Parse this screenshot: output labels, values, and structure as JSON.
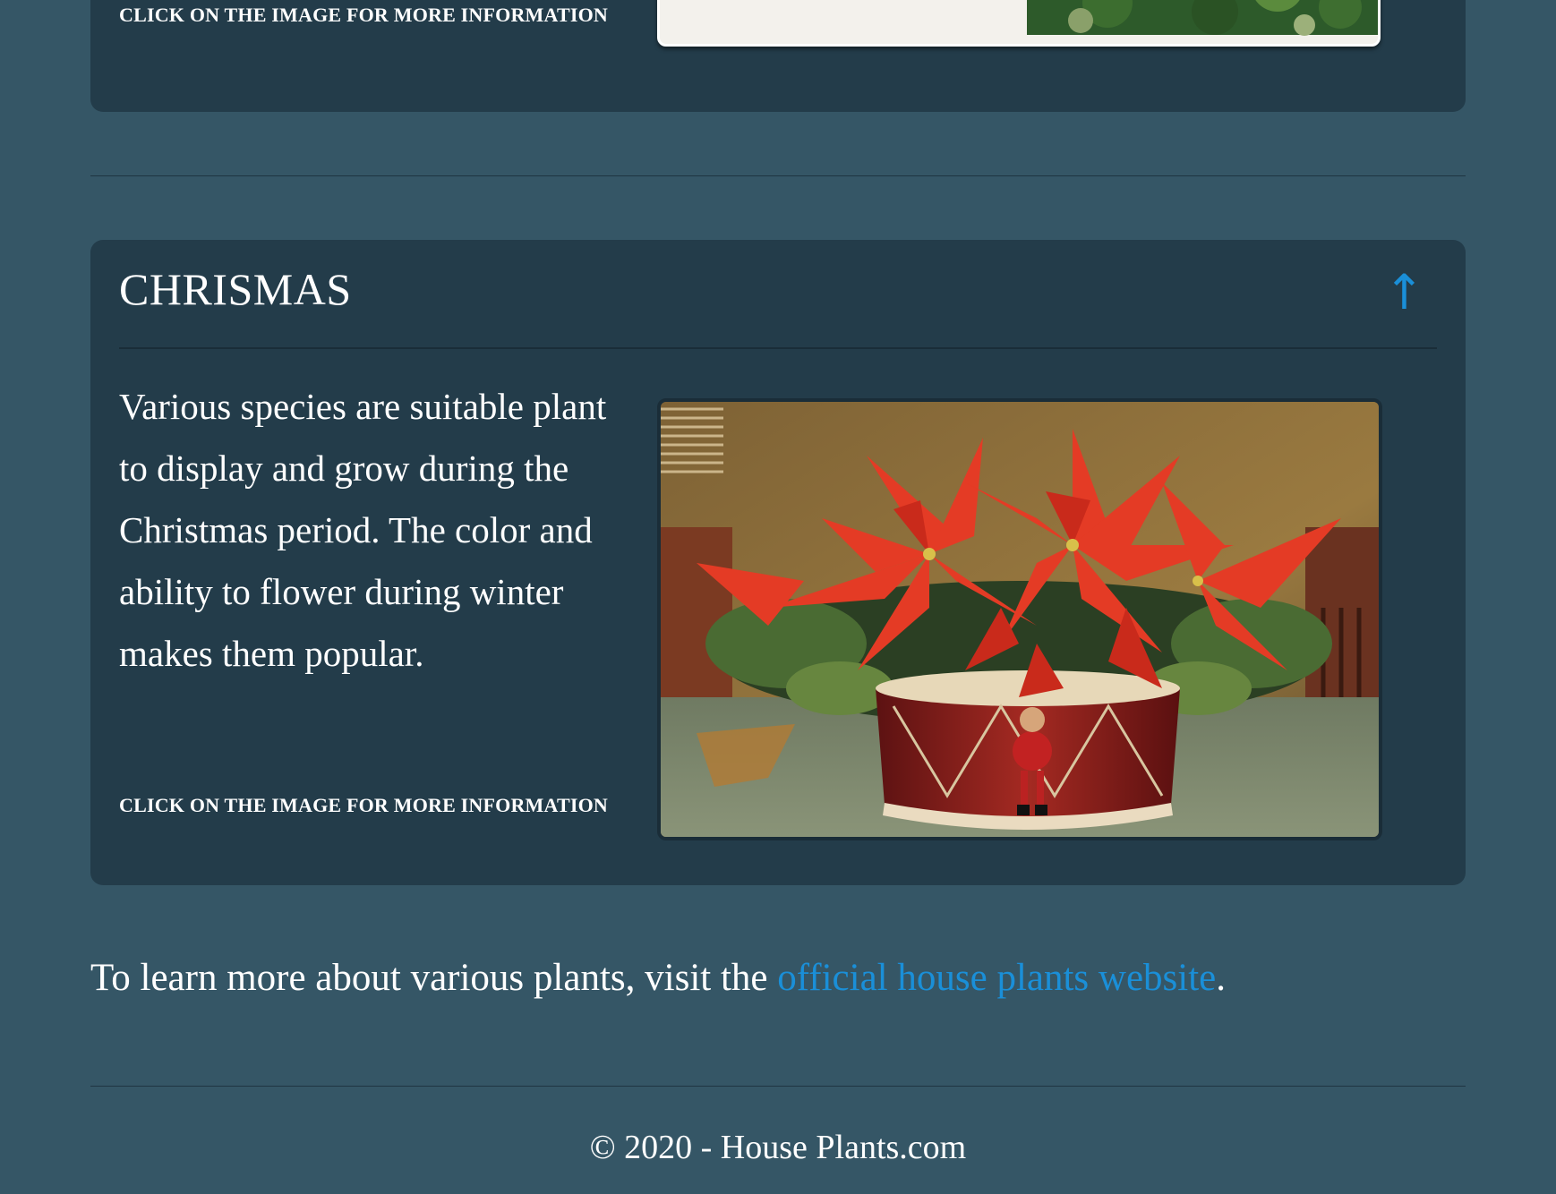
{
  "top_card": {
    "click_info": "CLICK ON THE IMAGE FOR MORE INFORMATION",
    "image_alt": "House plants"
  },
  "christmas_card": {
    "title": "CHRISMAS",
    "up_arrow": "↑",
    "description": "Various species are suitable plant to display and grow during the Christmas period. The color and ability to flower during winter makes them popular.",
    "click_info": "CLICK ON THE IMAGE FOR MORE INFORMATION",
    "image_alt": "Poinsettia"
  },
  "learn_more": {
    "prefix": "To learn more about various plants, visit the ",
    "link_text": "official house plants website",
    "suffix": "."
  },
  "footer": {
    "copyright": "© 2020 - House Plants.com"
  },
  "colors": {
    "background": "#355666",
    "card": "#233c4a",
    "link": "#1a8fd8"
  }
}
